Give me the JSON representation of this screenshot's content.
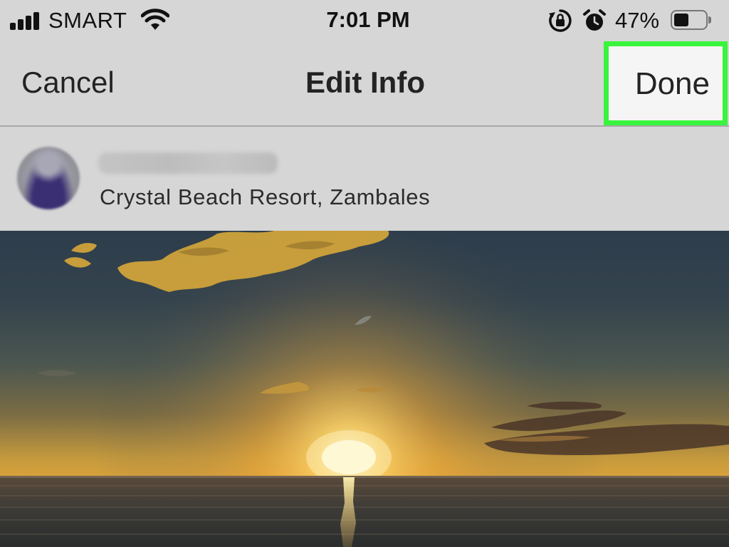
{
  "status_bar": {
    "carrier": "SMART",
    "time": "7:01 PM",
    "battery_percent": "47%",
    "battery_level": 0.47,
    "icons": {
      "signal": "cellular-signal-icon",
      "wifi": "wifi-icon",
      "orientation_lock": "orientation-lock-icon",
      "alarm": "alarm-clock-icon",
      "battery": "battery-icon"
    }
  },
  "nav": {
    "cancel_label": "Cancel",
    "title": "Edit Info",
    "done_label": "Done",
    "highlight_color": "#39f43c"
  },
  "post": {
    "location": "Crystal Beach Resort, Zambales"
  },
  "photo": {
    "description_icon": "sunset-photo"
  }
}
